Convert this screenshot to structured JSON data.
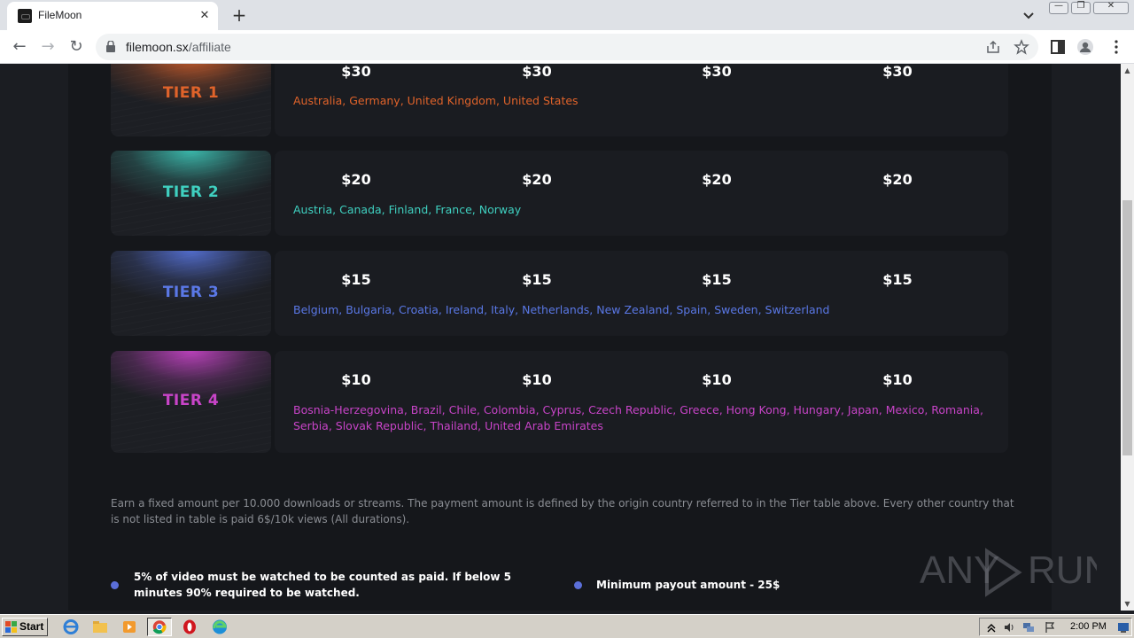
{
  "browser": {
    "tab_title": "FileMoon",
    "url_domain": "filemoon.sx",
    "url_path": "/affiliate"
  },
  "tiers": [
    {
      "label": "TIER 1",
      "color": "#e0632a",
      "prices": [
        "$30",
        "$30",
        "$30",
        "$30"
      ],
      "countries": "Australia, Germany, United Kingdom, United States"
    },
    {
      "label": "TIER 2",
      "color": "#3fd0c0",
      "prices": [
        "$20",
        "$20",
        "$20",
        "$20"
      ],
      "countries": "Austria, Canada, Finland, France, Norway"
    },
    {
      "label": "TIER 3",
      "color": "#5a78e6",
      "prices": [
        "$15",
        "$15",
        "$15",
        "$15"
      ],
      "countries": "Belgium, Bulgaria, Croatia, Ireland, Italy, Netherlands, New Zealand, Spain, Sweden, Switzerland"
    },
    {
      "label": "TIER 4",
      "color": "#c844c8",
      "prices": [
        "$10",
        "$10",
        "$10",
        "$10"
      ],
      "countries": "Bosnia-Herzegovina, Brazil, Chile, Colombia, Cyprus, Czech Republic, Greece, Hong Kong, Hungary, Japan, Mexico, Romania, Serbia, Slovak Republic, Thailand, United Arab Emirates"
    }
  ],
  "info_text": "Earn a fixed amount per 10.000 downloads or streams. The payment amount is defined by the origin country referred to in the Tier table above. Every other country that is not listed in table is paid 6$/10k views (All durations).",
  "notes": [
    "5% of video must be watched to be counted as paid. If below 5 minutes 90% required to be watched.",
    "Minimum payout amount - 25$"
  ],
  "watermark_text": "ANY RUN",
  "taskbar": {
    "start_label": "Start",
    "clock": "2:00 PM"
  }
}
